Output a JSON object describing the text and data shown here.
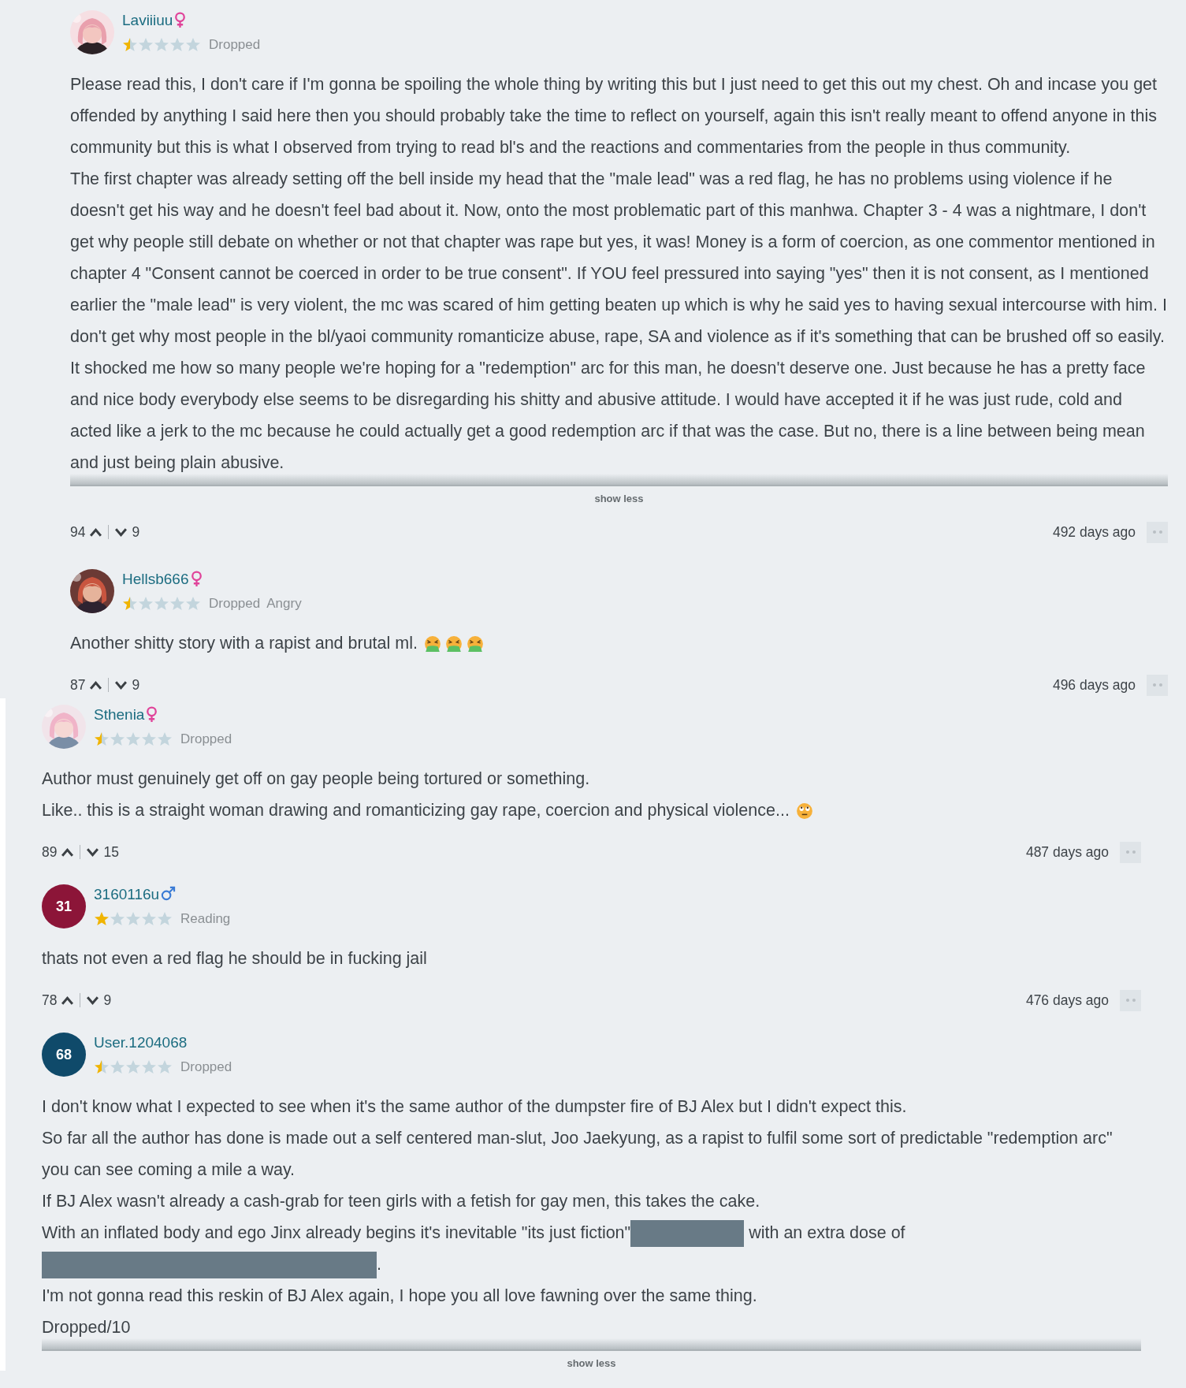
{
  "sections": [
    {
      "comments": [
        {
          "avatar": {
            "kind": "picture"
          },
          "name": "Laviiiuu",
          "gender": {
            "kind": "female",
            "color": "#e0449a"
          },
          "stars": 0.5,
          "tags": [
            "Dropped"
          ],
          "paragraphs": [
            {
              "segments": [
                {
                  "kind": "text",
                  "text": "Please read this, I don't care if I'm gonna be spoiling the whole thing by writing this but I just need to get this out my chest. Oh and incase you get offended by anything I said here then you should probably take the time to reflect on yourself, again this isn't really meant to offend anyone in this community but this is what I observed from trying to read bl's and the reactions and commentaries from the people in thus community."
                }
              ]
            },
            {
              "segments": [
                {
                  "kind": "text",
                  "text": "The first chapter was already setting off the bell inside my head that the \"male lead\" was a red flag, he has no problems using violence if he doesn't get his way and he doesn't feel bad about it. Now, onto the most problematic part of this manhwa. Chapter 3 - 4 was a nightmare, I don't get why people still debate on whether or not that chapter was rape but yes, it was! Money is a form of coercion, as one commentor mentioned in chapter 4 \"Consent cannot be coerced in order to be true consent\". If YOU feel pressured into saying \"yes\" then it is not consent, as I mentioned earlier the \"male lead\" is very violent, the mc was scared of him getting beaten up which is why he said yes to having sexual intercourse with him. I don't get why most people in the bl/yaoi community romanticize abuse, rape, SA and violence as if it's something that can be brushed off so easily. It shocked me how so many people we're hoping for a \"redemption\" arc for this man, he doesn't deserve one. Just because he has a pretty face and nice body everybody else seems to be disregarding his shitty and abusive attitude. I would have accepted it if he was just rude, cold and acted like a jerk to the mc because he could actually get a good redemption arc if that was the case. But no, there is a line between being mean and just being plain abusive."
                }
              ]
            }
          ],
          "toggle_label": "show less",
          "upvotes": "94",
          "downvotes": "9",
          "time": "492 days ago"
        },
        {
          "avatar": {
            "kind": "picture"
          },
          "name": "Hellsb666",
          "gender": {
            "kind": "female",
            "color": "#e0449a"
          },
          "stars": 0.5,
          "tags": [
            "Dropped",
            "Angry"
          ],
          "paragraphs": [
            {
              "segments": [
                {
                  "kind": "text",
                  "text": "Another shitty story with a rapist and brutal ml."
                },
                {
                  "kind": "vomiting-emoji"
                },
                {
                  "kind": "vomiting-emoji"
                },
                {
                  "kind": "vomiting-emoji"
                }
              ]
            }
          ],
          "upvotes": "87",
          "downvotes": "9",
          "time": "496 days ago"
        }
      ]
    },
    {
      "comments": [
        {
          "avatar": {
            "kind": "picture"
          },
          "name": "Sthenia",
          "gender": {
            "kind": "female",
            "color": "#e0449a"
          },
          "stars": 0.5,
          "tags": [
            "Dropped"
          ],
          "paragraphs": [
            {
              "segments": [
                {
                  "kind": "text",
                  "text": "Author must genuinely get off on gay people being tortured or something."
                }
              ]
            },
            {
              "segments": [
                {
                  "kind": "text",
                  "text": "Like.. this is a straight woman drawing and romanticizing gay rape, coercion and physical violence..."
                },
                {
                  "kind": "eye-roll-emoji"
                }
              ]
            }
          ],
          "upvotes": "89",
          "downvotes": "15",
          "time": "487 days ago"
        },
        {
          "avatar": {
            "kind": "initials",
            "text": "31",
            "color": "#8c1538"
          },
          "name": "3160116u",
          "gender": {
            "kind": "male",
            "color": "#3a7bd5"
          },
          "stars": 1,
          "tags": [
            "Reading"
          ],
          "paragraphs": [
            {
              "segments": [
                {
                  "kind": "text",
                  "text": "thats not even a red flag he should be in fucking jail"
                }
              ]
            }
          ],
          "upvotes": "78",
          "downvotes": "9",
          "time": "476 days ago"
        },
        {
          "avatar": {
            "kind": "initials",
            "text": "68",
            "color": "#0f4a6a"
          },
          "name": "User.1204068",
          "stars": 0.5,
          "tags": [
            "Dropped"
          ],
          "paragraphs": [
            {
              "segments": [
                {
                  "kind": "text",
                  "text": "I don't know what I expected to see when it's the same author of the dumpster fire of BJ Alex but I didn't expect this."
                }
              ]
            },
            {
              "segments": [
                {
                  "kind": "text",
                  "text": "So far all the author has done is made out a self centered man-slut, Joo Jaekyung, as a rapist to fulfil some sort of predictable \"redemption arc\""
                }
              ]
            },
            {
              "segments": [
                {
                  "kind": "text",
                  "text": "you can see coming a mile a way."
                }
              ]
            },
            {
              "segments": [
                {
                  "kind": "text",
                  "text": "If BJ Alex wasn't already a cash-grab for teen girls with a fetish for gay men, this takes the cake."
                }
              ]
            },
            {
              "segments": [
                {
                  "kind": "text",
                  "text": "With an inflated body and ego Jinx already begins it's inevitable \"its just fiction\""
                },
                {
                  "kind": "spoiler"
                },
                {
                  "kind": "text",
                  "text": "with an extra dose of"
                },
                {
                  "kind": "spoiler"
                },
                {
                  "kind": "text",
                  "text": "."
                }
              ]
            },
            {
              "segments": [
                {
                  "kind": "text",
                  "text": "I'm not gonna read this reskin of BJ Alex again, I hope you all love fawning over the same thing."
                }
              ]
            },
            {
              "segments": [
                {
                  "kind": "text",
                  "text": "Dropped/10"
                }
              ]
            }
          ],
          "toggle_label": "show less"
        }
      ]
    }
  ]
}
